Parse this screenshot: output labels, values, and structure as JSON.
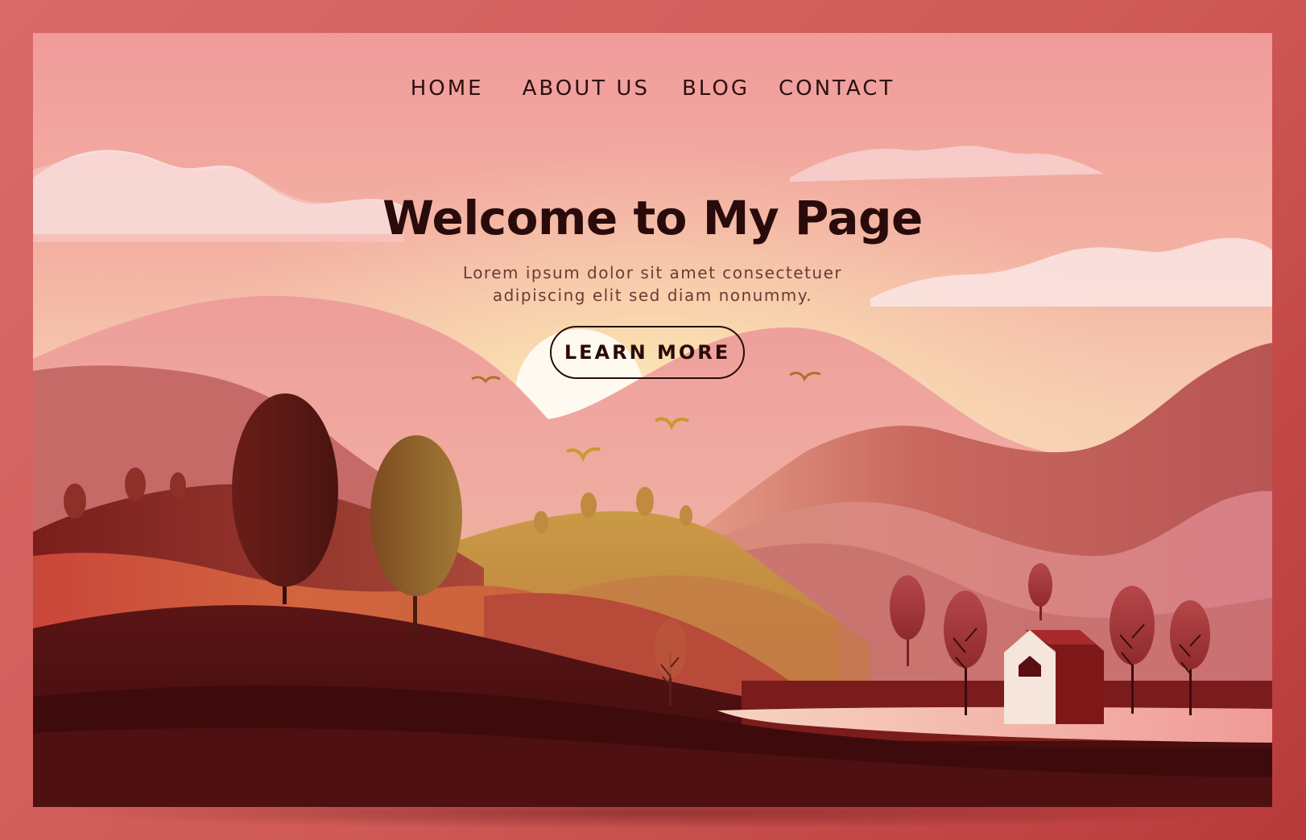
{
  "nav": {
    "items": [
      {
        "label": "HOME"
      },
      {
        "label": "ABOUT US"
      },
      {
        "label": "BLOG"
      },
      {
        "label": "CONTACT"
      }
    ]
  },
  "hero": {
    "title": "Welcome to My Page",
    "subtitle_line1": "Lorem ipsum dolor sit amet consectetuer",
    "subtitle_line2": "adipiscing elit sed diam nonummy.",
    "cta_label": "LEARN MORE"
  },
  "colors": {
    "frame": "#d86a68",
    "sky_top": "#f09b9b",
    "sky_glow": "#fbe5b8",
    "text_dark": "#2a0b0b",
    "hill_dark": "#4a0f10"
  }
}
